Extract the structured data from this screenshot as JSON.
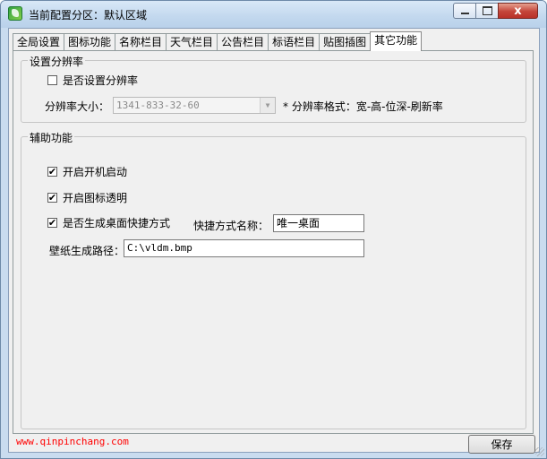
{
  "window": {
    "title": "当前配置分区：默认区域",
    "close_glyph": "x"
  },
  "tabs": [
    {
      "label": "全局设置"
    },
    {
      "label": "图标功能"
    },
    {
      "label": "名称栏目"
    },
    {
      "label": "天气栏目"
    },
    {
      "label": "公告栏目"
    },
    {
      "label": "标语栏目"
    },
    {
      "label": "贴图插图"
    },
    {
      "label": "其它功能"
    }
  ],
  "resolution_group": {
    "legend": "设置分辨率",
    "set_checkbox": {
      "label": "是否设置分辨率",
      "checked": false
    },
    "size_label": "分辨率大小：",
    "size_value": "1341-833-32-60",
    "format_hint": "* 分辨率格式：宽-高-位深-刷新率"
  },
  "aux_group": {
    "legend": "辅助功能",
    "startup": {
      "label": "开启开机启动",
      "checked": true
    },
    "icon_transparent": {
      "label": "开启图标透明",
      "checked": true
    },
    "desktop_shortcut": {
      "label": "是否生成桌面快捷方式",
      "checked": true
    },
    "shortcut_name_label": "快捷方式名称：",
    "shortcut_name_value": "唯一桌面",
    "wallpaper_label": "壁纸生成路径：",
    "wallpaper_value": "C:\\vldm.bmp"
  },
  "footer": {
    "website": "www.qinpinchang.com",
    "save_label": "保存"
  },
  "check_mark": "✔",
  "colors": {
    "footer_link": "#ff0000",
    "titlebar": "#c2d8ee",
    "close_button": "#c4453a"
  }
}
